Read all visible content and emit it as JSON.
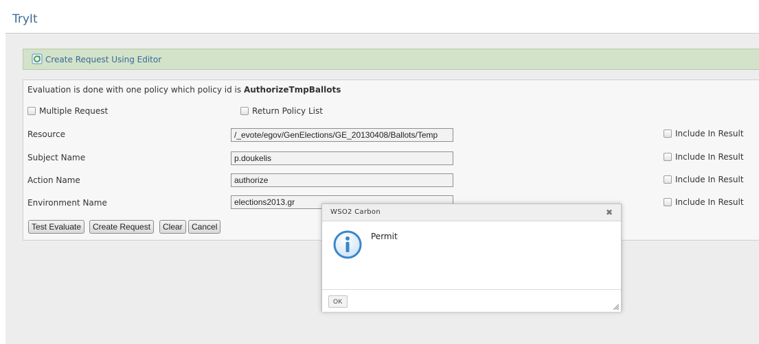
{
  "page": {
    "title": "TryIt"
  },
  "editor": {
    "header_label": "Create Request Using Editor"
  },
  "evaluation": {
    "text_prefix": "Evaluation is done with one policy which policy id is",
    "policy_id": "AuthorizeTmpBallots"
  },
  "options": {
    "multiple_request": "Multiple Request",
    "return_policy_list": "Return Policy List"
  },
  "rows": [
    {
      "label": "Resource",
      "value": "/_evote/egov/GenElections/GE_20130408/Ballots/Temp",
      "include": "Include In Result"
    },
    {
      "label": "Subject Name",
      "value": "p.doukelis",
      "include": "Include In Result"
    },
    {
      "label": "Action Name",
      "value": "authorize",
      "include": "Include In Result"
    },
    {
      "label": "Environment Name",
      "value": "elections2013.gr",
      "include": "Include In Result"
    }
  ],
  "buttons": {
    "test_evaluate": "Test Evaluate",
    "create_request": "Create Request",
    "clear": "Clear",
    "cancel": "Cancel"
  },
  "dialog": {
    "title": "WSO2 Carbon",
    "close": "✖",
    "message": "Permit",
    "ok": "OK"
  },
  "colors": {
    "accent": "#3b6a96",
    "editor_header_bg": "#d3e3c9",
    "panel_bg": "#f7f7f7"
  }
}
